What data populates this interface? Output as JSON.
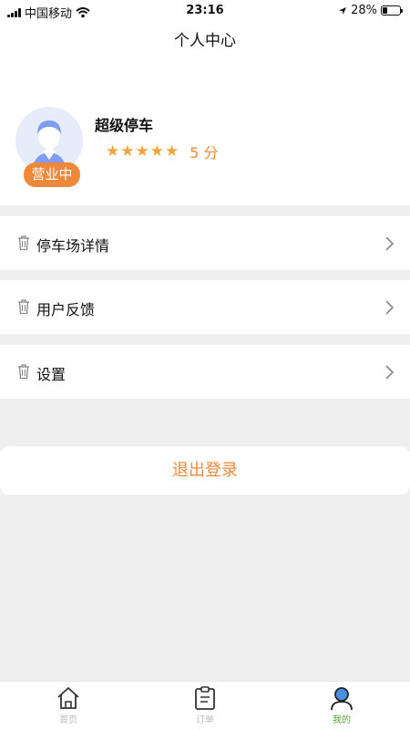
{
  "status": {
    "carrier": "中国移动",
    "time": "23:16",
    "battery": "28%",
    "battery_level": 0.28
  },
  "header": {
    "title": "个人中心"
  },
  "profile": {
    "name": "超级停车",
    "badge": "营业中",
    "stars": 5,
    "score": "5 分"
  },
  "menu": [
    {
      "label": "停车场详情",
      "icon": "trash-icon"
    },
    {
      "label": "用户反馈",
      "icon": "trash-icon"
    },
    {
      "label": "设置",
      "icon": "trash-icon"
    }
  ],
  "logout": {
    "label": "退出登录"
  },
  "tabs": [
    {
      "label": "首页",
      "icon": "home-icon",
      "active": false
    },
    {
      "label": "订单",
      "icon": "clipboard-icon",
      "active": false
    },
    {
      "label": "我的",
      "icon": "user-icon",
      "active": true
    }
  ],
  "colors": {
    "accent": "#f0883a",
    "star": "#f0a43a",
    "tab_active": "#58a832",
    "tab_inactive": "#bbbbbb",
    "background": "#efefef"
  }
}
